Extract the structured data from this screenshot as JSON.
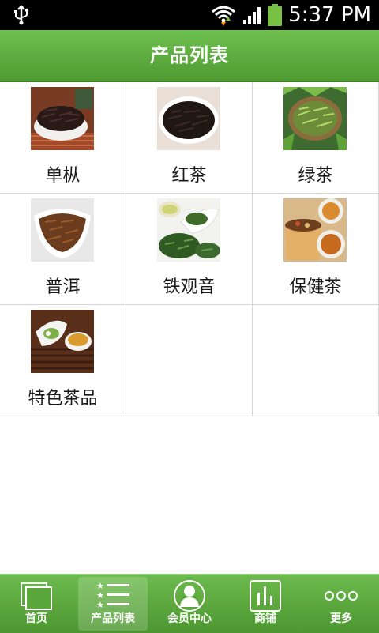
{
  "status_bar": {
    "time": "5:37 PM",
    "icons": [
      "usb-icon",
      "wifi-icon",
      "signal-icon",
      "battery-icon"
    ]
  },
  "header": {
    "title": "产品列表"
  },
  "products": [
    {
      "name": "单枞",
      "image": "dancong-tea-photo"
    },
    {
      "name": "红茶",
      "image": "black-tea-photo"
    },
    {
      "name": "绿茶",
      "image": "green-tea-photo"
    },
    {
      "name": "普洱",
      "image": "puer-tea-photo"
    },
    {
      "name": "铁观音",
      "image": "tieguanyin-tea-photo"
    },
    {
      "name": "保健茶",
      "image": "health-tea-photo"
    },
    {
      "name": "特色茶品",
      "image": "specialty-tea-photo"
    }
  ],
  "tabs": [
    {
      "label": "首页",
      "icon": "home-icon",
      "active": false
    },
    {
      "label": "产品列表",
      "icon": "list-icon",
      "active": true
    },
    {
      "label": "会员中心",
      "icon": "user-icon",
      "active": false
    },
    {
      "label": "商铺",
      "icon": "chart-icon",
      "active": false
    },
    {
      "label": "更多",
      "icon": "more-icon",
      "active": false
    }
  ],
  "colors": {
    "brand_green": "#5aab3c",
    "status_bar": "#000000",
    "grid_line": "#d6d6d6",
    "battery": "#79c142"
  }
}
